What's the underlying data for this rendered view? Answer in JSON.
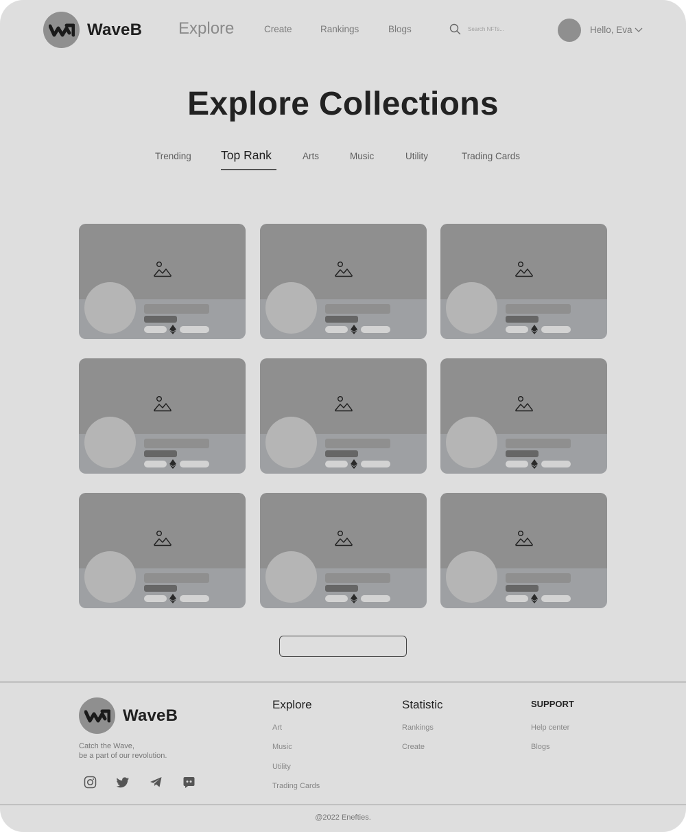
{
  "brand": {
    "name": "WaveB",
    "tagline_line1": "Catch the Wave,",
    "tagline_line2": "be a part of our revolution."
  },
  "nav": {
    "explore": "Explore",
    "links": [
      "Create",
      "Rankings",
      "Blogs"
    ],
    "search_placeholder": "Search NFTs...",
    "greeting": "Hello, Eva"
  },
  "hero": {
    "title": "Explore Collections"
  },
  "tabs": [
    {
      "label": "Trending"
    },
    {
      "label": "Top Rank",
      "active": true
    },
    {
      "label": "Arts"
    },
    {
      "label": "Music"
    },
    {
      "label": "Utility"
    },
    {
      "label": "Trading Cards"
    }
  ],
  "footer": {
    "columns": [
      {
        "title": "Explore",
        "links": [
          "Art",
          "Music",
          "Utility",
          "Trading Cards"
        ]
      },
      {
        "title": "Statistic",
        "links": [
          "Rankings",
          "Create"
        ]
      },
      {
        "title": "SUPPORT",
        "links": [
          "Help center",
          "Blogs"
        ]
      }
    ],
    "social_icons": [
      "instagram-icon",
      "twitter-icon",
      "telegram-icon",
      "discord-icon"
    ],
    "copyright": "@2022 Enefties."
  },
  "colors": {
    "page_bg": "#dedede",
    "card_banner": "#8f8f8f",
    "card_body": "#9ea0a3"
  }
}
